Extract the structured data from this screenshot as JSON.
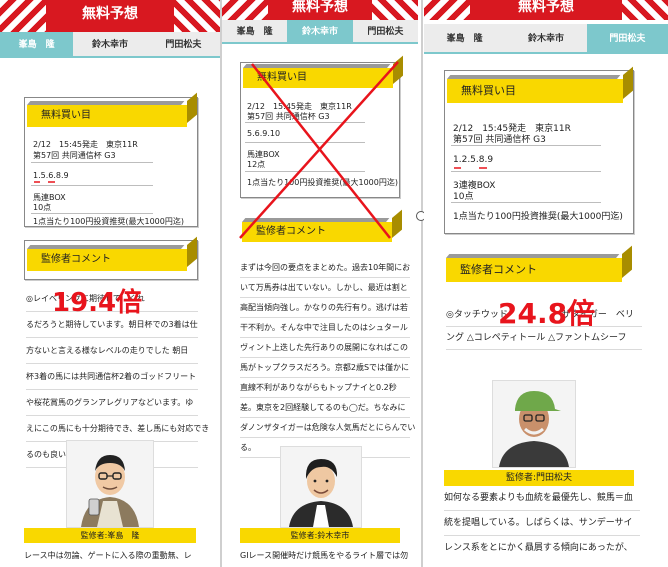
{
  "header": {
    "title": "無料予想"
  },
  "panel1": {
    "tabs": [
      "峯島　隆",
      "鈴木幸市",
      "門田松夫"
    ],
    "active_tab": 0,
    "buy": {
      "heading": "無料買い目",
      "race": "2/12　15:45発走　東京11R",
      "race_name": "第57回 共同通信杯 G3",
      "numbers": "1.5.6.8.9",
      "type": "馬連BOX",
      "points": "10点",
      "note": "1点当たり100円投資推奨(最大1000円迄)"
    },
    "comment_heading": "監修者コメント",
    "big_odds": "19.4倍",
    "comment_lines": [
      "◎レイベリングに期待して　くれ",
      "るだろうと期待しています。朝日杯での3着は仕",
      "方ないと言える様なレベルの走りでした 朝日",
      "杯3着の馬には共同通信杯2着のゴッドフリート",
      "や桜花賞馬のグランアレグリアなどいます。ゆ",
      "えにこの馬にも十分期待でき、差し馬にも対応でき",
      "るのも良いです。"
    ],
    "supervisor_caption": "監修者:峯島　隆",
    "bottom_text": "レース中は勿論、ゲートに入る際の重動無、レ"
  },
  "panel2": {
    "tabs": [
      "峯島　隆",
      "鈴木幸市",
      "門田松夫"
    ],
    "active_tab": 1,
    "buy": {
      "heading": "無料買い目",
      "race": "2/12　15:45発走　東京11R",
      "race_name": "第57回 共同通信杯 G3",
      "numbers": "5.6.9.10",
      "type": "馬連BOX",
      "points": "12点",
      "note": "1点当たり100円投資推奨(最大1000円迄)"
    },
    "comment_heading": "監修者コメント",
    "comment_lines": [
      "まずは今回の要点をまとめた。過去10年間にお",
      "いて万馬券は出ていない。しかし、最近は割と",
      "高配当傾向強し。かなりの先行有り。逃げは若",
      "干不利か。そんな中で注目したのはシュタール",
      "ヴィント上迭した先行ありの展開になればこの",
      "馬がトップクラスだろう。京都2歳Sでは僅かに",
      "直線不利がありながらもトップナイと0.2秒",
      "差。東京を2回経験してるのも◯だ。ちなみに",
      "ダノンザタイガーは危険な人気馬だとにらんでい",
      "る。"
    ],
    "supervisor_caption": "監修者:鈴木幸市",
    "bottom_text": "GIレース開催時だけ競馬をやるライト層では勿"
  },
  "panel3": {
    "tabs": [
      "峯島　隆",
      "鈴木幸市",
      "門田松夫"
    ],
    "active_tab": 2,
    "buy": {
      "heading": "無料買い目",
      "race": "2/12　15:45発走　東京11R",
      "race_name": "第57回 共同通信杯 G3",
      "numbers": "1.2.5.8.9",
      "type": "3連複BOX",
      "points": "10点",
      "note": "1点当たり100円投資推奨(最大1000円迄)"
    },
    "comment_heading": "監修者コメント",
    "big_odds": "24.8倍",
    "comment_lines": [
      "◎タッチウッド　　　　　　ザタイガー　ベリ",
      "ング △コレペティトール △ファントムシーフ"
    ],
    "supervisor_caption": "監修者:門田松夫",
    "bottom_lines": [
      "如何なる要素よりも血統を最優先し、競馬＝血",
      "統を提唱している。しばらくは、サンデーサイ",
      "レンス系をとにかく贔屓する傾向にあったが、"
    ]
  },
  "colors": {
    "red": "#d81820",
    "yellow": "#f9d800",
    "teal": "#7dc8cc",
    "odds_red": "#e8141c"
  }
}
